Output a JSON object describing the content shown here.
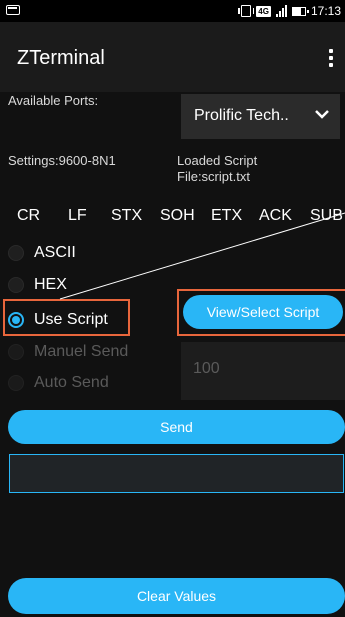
{
  "status_bar": {
    "time": "17:13",
    "network": "4G",
    "icons": [
      "screenshot-icon",
      "vibrate-icon",
      "lte-icon",
      "signal-icon",
      "battery-icon"
    ]
  },
  "app_bar": {
    "title": "ZTerminal",
    "menu_icon": "overflow-menu-icon"
  },
  "ports": {
    "label": "Available Ports:",
    "selected": "Prolific Tech.."
  },
  "settings": {
    "text": "Settings:9600-8N1",
    "loaded_script": "Loaded Script\nFile:script.txt"
  },
  "control_chars": [
    "CR",
    "LF",
    "STX",
    "SOH",
    "ETX",
    "ACK",
    "SUB"
  ],
  "modes": {
    "ascii": "ASCII",
    "hex": "HEX",
    "use_script": "Use Script",
    "manual_send": "Manuel Send",
    "auto_send": "Auto Send",
    "selected": "Use Script"
  },
  "buttons": {
    "view_select_script": "View/Select Script",
    "send": "Send",
    "clear_values": "Clear Values"
  },
  "interval": {
    "value": "100"
  },
  "output": {
    "value": ""
  },
  "colors": {
    "accent": "#29b6f6",
    "highlight": "#e8663c",
    "background": "#111111"
  }
}
